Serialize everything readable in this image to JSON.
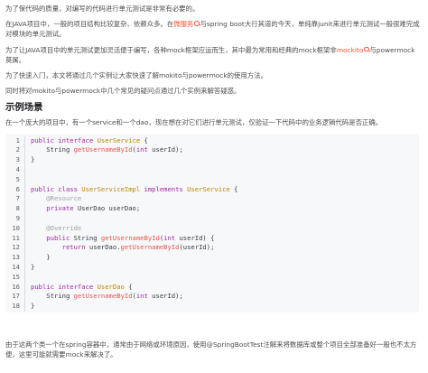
{
  "intro": {
    "line1": "为了保代码的质量，对编写的代码进行单元测试是非常有必要的。",
    "line2_before": "在JAVA项目中，一般的项目结构比较复杂、依赖众多。在",
    "line2_link": "微服务",
    "line2_after": "与spring boot大行其道的今天，单纯靠junit来进行单元测试一般很难完成对模块的单元测试。",
    "line3_before": "为了让JAVA项目中的单元测试更加灵活便于编写，各种mock框架应运而生，其中最为常用和经典的mock框架非",
    "line3_link": "mockito",
    "line3_after": "与powermock莫属。",
    "line4": "为了快速入门，本文将通过几个实例让大家快速了解mokito与powermock的使用方法。",
    "line5": "同时将对mokito与powermock中几个常见的疑问点通过几个实例来解答疑惑。"
  },
  "section": {
    "heading": "示例场景",
    "desc": "在一个庞大的项目中，有一个service和一个dao，现在想在对它们进行单元测试，仅验证一下代码中的业务逻辑代码是否正确。"
  },
  "code_lines": [
    [
      {
        "c": "k",
        "t": "public interface "
      },
      {
        "c": "t",
        "t": "UserService"
      },
      {
        "c": "",
        "t": " {"
      }
    ],
    [
      {
        "c": "",
        "t": "    String "
      },
      {
        "c": "f",
        "t": "getUsernameById"
      },
      {
        "c": "",
        "t": "("
      },
      {
        "c": "k",
        "t": "int"
      },
      {
        "c": "",
        "t": " userId);"
      }
    ],
    [
      {
        "c": "",
        "t": "}"
      }
    ],
    [],
    [],
    [
      {
        "c": "k",
        "t": "public class "
      },
      {
        "c": "t",
        "t": "UserServiceImpl "
      },
      {
        "c": "k",
        "t": "implements "
      },
      {
        "c": "t",
        "t": "UserService"
      },
      {
        "c": "",
        "t": " {"
      }
    ],
    [
      {
        "c": "c",
        "t": "    @Resource"
      }
    ],
    [
      {
        "c": "k",
        "t": "    private "
      },
      {
        "c": "",
        "t": "UserDao userDao;"
      }
    ],
    [],
    [
      {
        "c": "c",
        "t": "    @Override"
      }
    ],
    [
      {
        "c": "k",
        "t": "    public "
      },
      {
        "c": "",
        "t": "String "
      },
      {
        "c": "f",
        "t": "getUsernameById"
      },
      {
        "c": "",
        "t": "("
      },
      {
        "c": "k",
        "t": "int"
      },
      {
        "c": "",
        "t": " userId) {"
      }
    ],
    [
      {
        "c": "k",
        "t": "        return "
      },
      {
        "c": "",
        "t": "userDao."
      },
      {
        "c": "f",
        "t": "getUsernameById"
      },
      {
        "c": "",
        "t": "(userId);"
      }
    ],
    [
      {
        "c": "",
        "t": "    }"
      }
    ],
    [
      {
        "c": "",
        "t": "}"
      }
    ],
    [],
    [
      {
        "c": "k",
        "t": "public interface "
      },
      {
        "c": "t",
        "t": "UserDao"
      },
      {
        "c": "",
        "t": " {"
      }
    ],
    [
      {
        "c": "",
        "t": "    String "
      },
      {
        "c": "f",
        "t": "getUsernameById"
      },
      {
        "c": "",
        "t": "("
      },
      {
        "c": "k",
        "t": "int"
      },
      {
        "c": "",
        "t": " userId);"
      }
    ],
    [
      {
        "c": "",
        "t": "}"
      }
    ]
  ],
  "outro": "由于这两个类一个在spring容器中，通常由于网络或环境原因，使用@SpringBootTest注解来将数据库或整个项目全部准备好一般也不太方便，这里可能就需要mock来解决了。"
}
